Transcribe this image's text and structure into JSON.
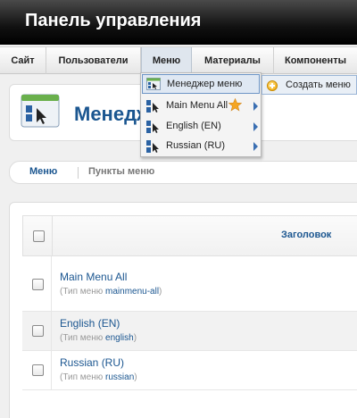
{
  "header": {
    "title": "Панель управления"
  },
  "menubar": {
    "items": [
      {
        "label": "Сайт"
      },
      {
        "label": "Пользователи"
      },
      {
        "label": "Меню"
      },
      {
        "label": "Материалы"
      },
      {
        "label": "Компоненты"
      }
    ]
  },
  "page": {
    "title": "Менеджер меню"
  },
  "tabs": [
    {
      "label": "Меню"
    },
    {
      "label": "Пункты меню"
    }
  ],
  "table": {
    "header": {
      "title_col": "Заголовок"
    },
    "rows": [
      {
        "name": "Main Menu All",
        "type_prefix": "(Тип меню ",
        "type_value": "mainmenu-all",
        "type_suffix": ")"
      },
      {
        "name": "English (EN)",
        "type_prefix": "(Тип меню ",
        "type_value": "english",
        "type_suffix": ")"
      },
      {
        "name": "Russian (RU)",
        "type_prefix": "(Тип меню ",
        "type_value": "russian",
        "type_suffix": ")"
      }
    ]
  },
  "dropdown": {
    "items": [
      {
        "label": "Менеджер меню"
      },
      {
        "label": "Main Menu All"
      },
      {
        "label": "English (EN)"
      },
      {
        "label": "Russian (RU)"
      }
    ]
  },
  "submenu": {
    "label": "Создать меню"
  },
  "colors": {
    "accent": "#1b5690",
    "highlight": "#dfe8f3",
    "star": "#f5a623"
  }
}
